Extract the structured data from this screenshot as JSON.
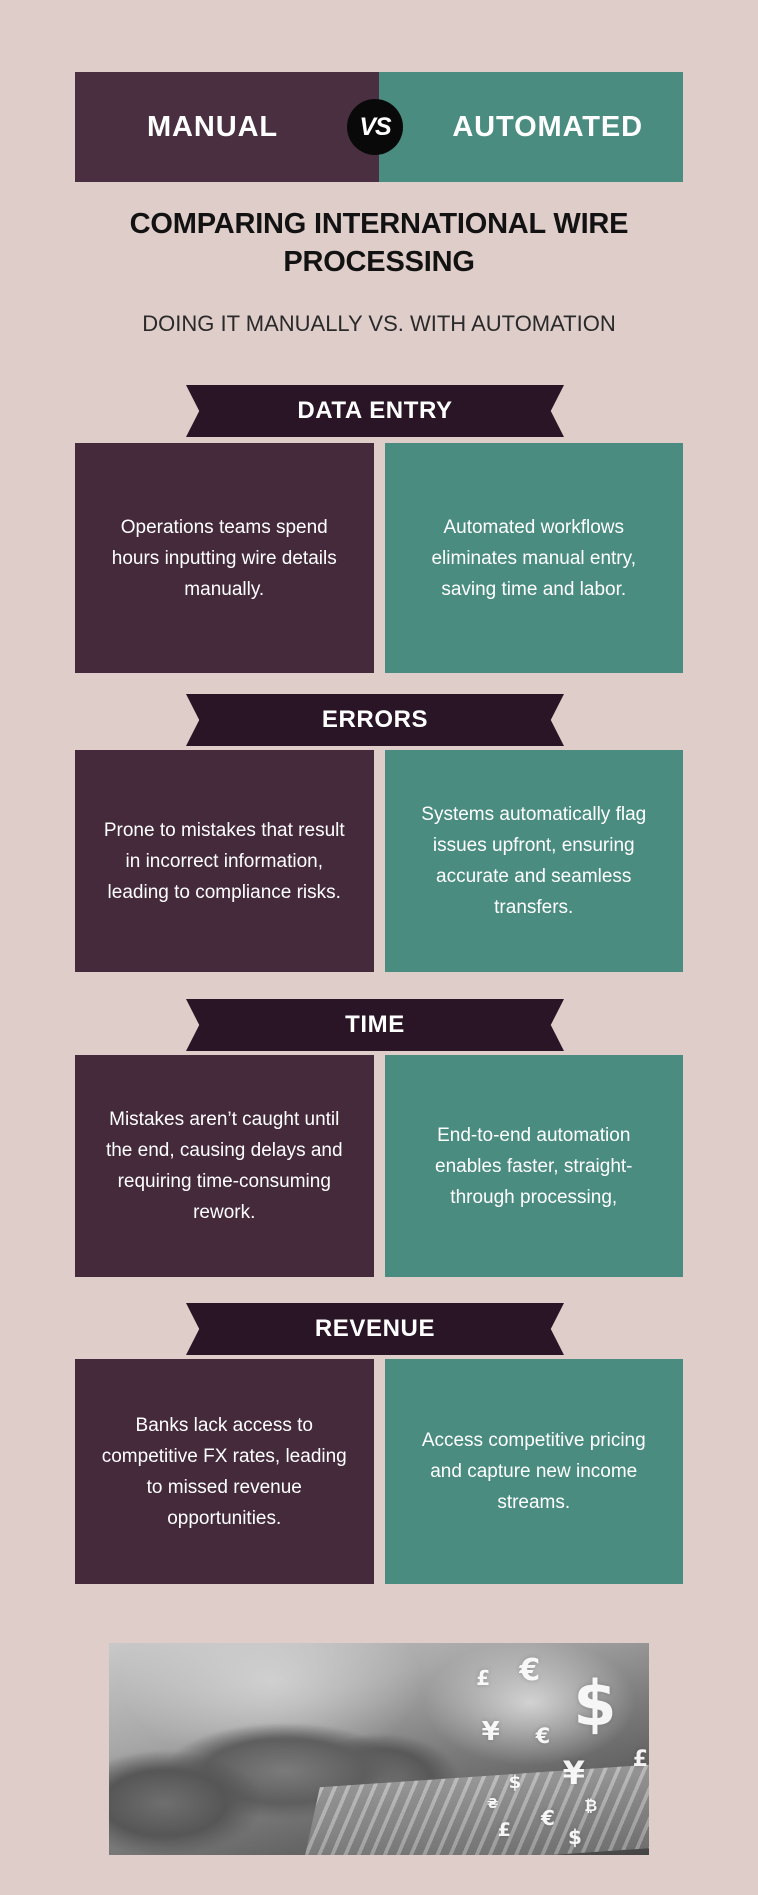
{
  "background_color": "#dfcdc9",
  "header": {
    "left_label": "MANUAL",
    "right_label": "AUTOMATED",
    "badge_label": "VS",
    "badge_icon": "vs-badge-icon",
    "left_color": "#4a2f41",
    "right_color": "#4a8c80",
    "badge_color": "#090909"
  },
  "title": "COMPARING INTERNATIONAL WIRE PROCESSING",
  "subtitle": "DOING IT MANUALLY VS. WITH AUTOMATION",
  "sections": [
    {
      "banner": "DATA ENTRY",
      "manual": "Operations teams spend hours inputting wire details manually.",
      "automated": "Automated workflows eliminates manual entry, saving time and labor."
    },
    {
      "banner": "ERRORS",
      "manual": "Prone to mistakes that result in incorrect information, leading to compliance risks.",
      "automated": "Systems automatically flag issues upfront, ensuring accurate and seamless transfers."
    },
    {
      "banner": "TIME",
      "manual": "Mistakes aren’t caught until the end, causing delays and requiring time-consuming rework.",
      "automated": "End-to-end automation enables faster, straight-through processing,"
    },
    {
      "banner": "REVENUE",
      "manual": "Banks lack access to competitive FX rates, leading to missed revenue opportunities.",
      "automated": "Access competitive pricing and capture new income streams."
    }
  ],
  "photo": {
    "description": "Grayscale photo of hands typing on a laptop keyboard with floating currency symbols",
    "symbols": [
      "£",
      "€",
      "¥",
      "$",
      "€",
      "¥",
      "£",
      "$",
      "₴",
      "€",
      "£",
      "₿",
      "$"
    ]
  },
  "colors": {
    "manual_card": "#442a3b",
    "automated_card": "#4a8c80",
    "ribbon": "#2a1526",
    "text_light": "#ffffff",
    "text_dark": "#121212"
  }
}
